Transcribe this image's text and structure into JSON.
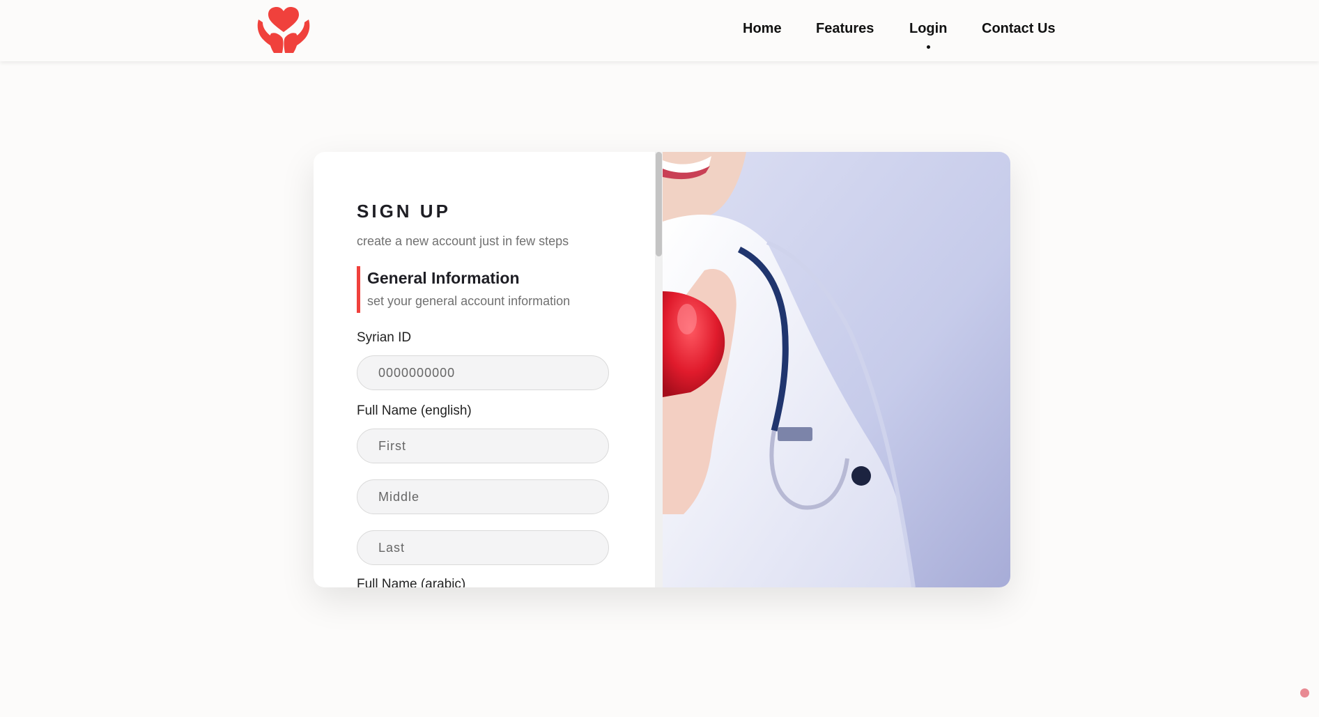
{
  "nav": {
    "items": [
      {
        "label": "Home"
      },
      {
        "label": "Features"
      },
      {
        "label": "Login"
      },
      {
        "label": "Contact Us"
      }
    ],
    "active": "Login"
  },
  "brand": {
    "accent_color": "#f0413c",
    "logo_icon": "hands-heart-icon"
  },
  "signup": {
    "title": "SIGN UP",
    "subtitle": "create a new account just in few steps",
    "section_title": "General Information",
    "section_subtitle": "set your general account information",
    "syrian_id": {
      "label": "Syrian ID",
      "placeholder": "0000000000",
      "value": ""
    },
    "name_en": {
      "label": "Full Name (english)",
      "first_placeholder": "First",
      "middle_placeholder": "Middle",
      "last_placeholder": "Last"
    },
    "name_ar": {
      "label": "Full Name (arabic)"
    }
  },
  "side_image": {
    "subject": "doctor-with-heart-and-stethoscope"
  }
}
